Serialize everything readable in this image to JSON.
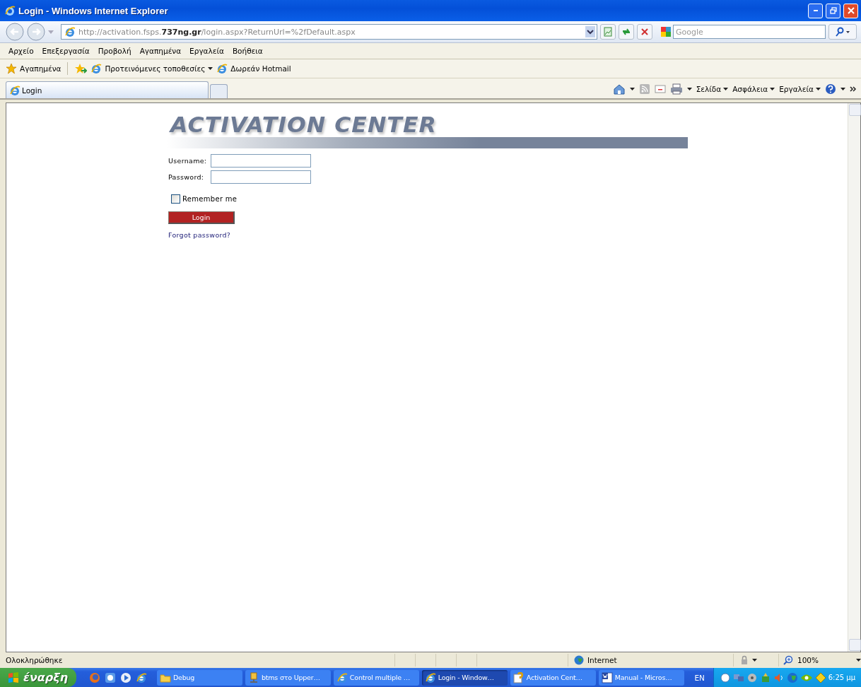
{
  "window": {
    "title": "Login - Windows Internet Explorer"
  },
  "address": {
    "url": "http://activation.fsps.**737ng.gr**/login.aspx?ReturnUrl=%2fDefault.aspx"
  },
  "search": {
    "placeholder": "Google"
  },
  "menu": [
    "Αρχείο",
    "Επεξεργασία",
    "Προβολή",
    "Αγαπημένα",
    "Εργαλεία",
    "Βοήθεια"
  ],
  "favorites_bar": {
    "label": "Αγαπημένα",
    "links": [
      {
        "label": "Προτεινόμενες τοποθεσίες",
        "dropdown": true
      },
      {
        "label": "Δωρεάν Hotmail",
        "dropdown": false
      }
    ]
  },
  "tabs": [
    {
      "label": "Login",
      "selected": true
    }
  ],
  "command_bar": [
    "Σελίδα",
    "Ασφάλεια",
    "Εργαλεία"
  ],
  "page": {
    "logo": "ACTIVATION CENTER",
    "fields": [
      {
        "label": "Username:"
      },
      {
        "label": "Password:"
      }
    ],
    "remember": {
      "label": "Remember me",
      "checked": false
    },
    "login_button": "Login",
    "forgot_link": "Forgot password?"
  },
  "status_bar": {
    "text": "Ολοκληρώθηκε",
    "zone": "Internet",
    "zoom": "100%"
  },
  "taskbar": {
    "start": "έναρξη",
    "tasks": [
      {
        "label": "Debug",
        "selected": false,
        "kind": "folder"
      },
      {
        "label": "btms στο Upper…",
        "selected": false,
        "kind": "network"
      },
      {
        "label": "Control multiple …",
        "selected": false,
        "kind": "ie"
      },
      {
        "label": "Login - Window…",
        "selected": true,
        "kind": "ie"
      },
      {
        "label": "Activation Cent…",
        "selected": false,
        "kind": "help"
      },
      {
        "label": "Manual - Micros…",
        "selected": false,
        "kind": "word"
      }
    ],
    "language": "EN",
    "clock": "6:25 μμ"
  }
}
